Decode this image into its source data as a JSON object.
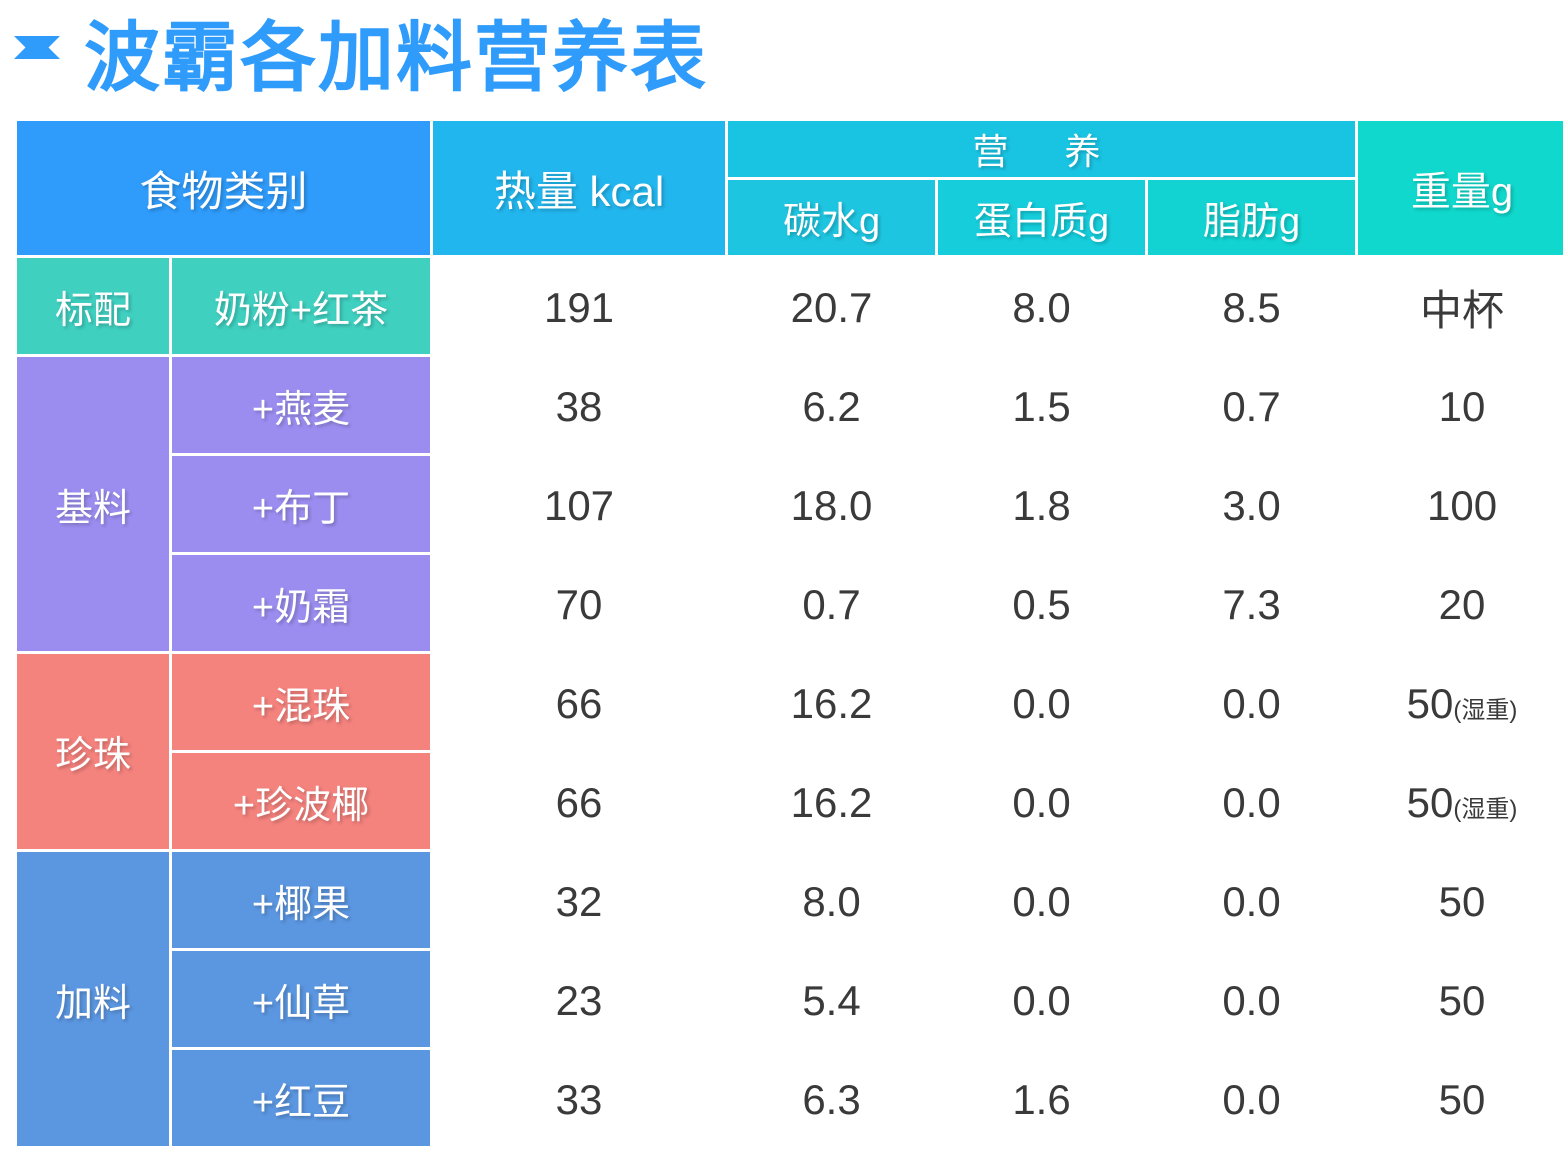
{
  "title": {
    "text": "波霸各加料营养表",
    "bullet_icon": "diamond-icon",
    "color": "#2f9bfa"
  },
  "table": {
    "headers": {
      "category": "食物类别",
      "calories": "热量 kcal",
      "nutrition_group": "营　养",
      "carbs": "碳水g",
      "protein": "蛋白质g",
      "fat": "脂肪g",
      "weight": "重量g"
    },
    "groups": [
      {
        "name": "标配",
        "color": "#3fd0c0",
        "rows": [
          {
            "item": "奶粉+红茶",
            "kcal": "191",
            "carbs": "20.7",
            "protein": "8.0",
            "fat": "8.5",
            "weight": "中杯",
            "weight_note": ""
          }
        ]
      },
      {
        "name": "基料",
        "color": "#9b8df0",
        "rows": [
          {
            "item": "+燕麦",
            "kcal": "38",
            "carbs": "6.2",
            "protein": "1.5",
            "fat": "0.7",
            "weight": "10",
            "weight_note": ""
          },
          {
            "item": "+布丁",
            "kcal": "107",
            "carbs": "18.0",
            "protein": "1.8",
            "fat": "3.0",
            "weight": "100",
            "weight_note": ""
          },
          {
            "item": "+奶霜",
            "kcal": "70",
            "carbs": "0.7",
            "protein": "0.5",
            "fat": "7.3",
            "weight": "20",
            "weight_note": ""
          }
        ]
      },
      {
        "name": "珍珠",
        "color": "#f4827d",
        "rows": [
          {
            "item": "+混珠",
            "kcal": "66",
            "carbs": "16.2",
            "protein": "0.0",
            "fat": "0.0",
            "weight": "50",
            "weight_note": "(湿重)"
          },
          {
            "item": "+珍波椰",
            "kcal": "66",
            "carbs": "16.2",
            "protein": "0.0",
            "fat": "0.0",
            "weight": "50",
            "weight_note": "(湿重)"
          }
        ]
      },
      {
        "name": "加料",
        "color": "#5b96e0",
        "rows": [
          {
            "item": "+椰果",
            "kcal": "32",
            "carbs": "8.0",
            "protein": "0.0",
            "fat": "0.0",
            "weight": "50",
            "weight_note": ""
          },
          {
            "item": "+仙草",
            "kcal": "23",
            "carbs": "5.4",
            "protein": "0.0",
            "fat": "0.0",
            "weight": "50",
            "weight_note": ""
          },
          {
            "item": "+红豆",
            "kcal": "33",
            "carbs": "6.3",
            "protein": "1.6",
            "fat": "0.0",
            "weight": "50",
            "weight_note": ""
          }
        ]
      }
    ]
  }
}
